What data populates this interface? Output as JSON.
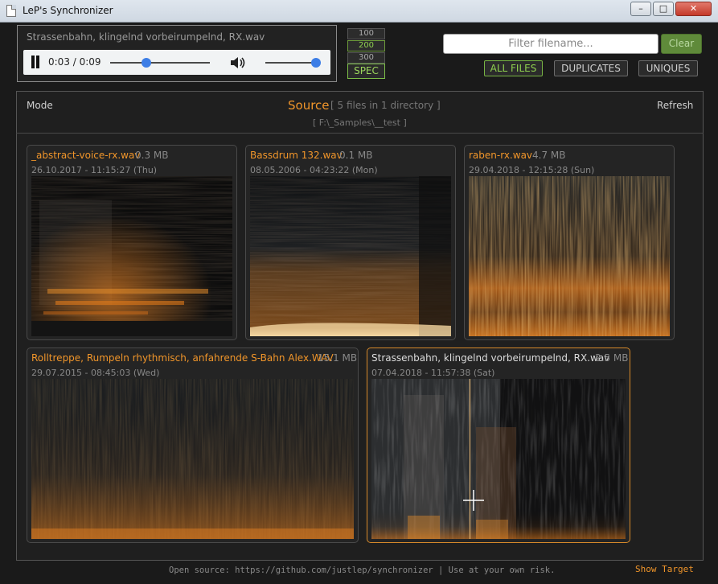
{
  "window": {
    "title": "LeP's Synchronizer"
  },
  "player": {
    "filename": "Strassenbahn, klingelnd vorbeirumpelnd, RX.wav",
    "time": "0:03 / 0:09",
    "progress": 0.36,
    "volume": 1.0
  },
  "spectro_res": {
    "options": [
      "100",
      "200",
      "300"
    ],
    "active": "200",
    "spec_label": "SPEC"
  },
  "filter": {
    "placeholder": "Filter filename...",
    "clear_label": "Clear"
  },
  "tabs": [
    {
      "label": "ALL FILES",
      "active": true
    },
    {
      "label": "DUPLICATES",
      "active": false
    },
    {
      "label": "UNIQUES",
      "active": false
    }
  ],
  "panel": {
    "mode_label": "Mode",
    "refresh_label": "Refresh",
    "title": "Source",
    "count": "[ 5 files in 1 directory ]",
    "path": "[ F:\\_Samples\\__test ]"
  },
  "files": [
    {
      "name": "_abstract-voice-rx.wav",
      "size": "0.3 MB",
      "date": "26.10.2017 - 11:15:27 (Thu)",
      "selected": false
    },
    {
      "name": "Bassdrum 132.wav",
      "size": "0.1 MB",
      "date": "08.05.2006 - 04:23:22 (Mon)",
      "selected": false
    },
    {
      "name": "raben-rx.wav",
      "size": "4.7 MB",
      "date": "29.04.2018 - 12:15:28 (Sun)",
      "selected": false
    },
    {
      "name": "Rolltreppe, Rumpeln rhythmisch, anfahrende S-Bahn Alex.WAV",
      "size": "15.1 MB",
      "date": "29.07.2015 - 08:45:03 (Wed)",
      "selected": false
    },
    {
      "name": "Strassenbahn, klingelnd vorbeirumpelnd, RX.wav",
      "size": "2.5 MB",
      "date": "07.04.2018 - 11:57:38 (Sat)",
      "selected": true
    }
  ],
  "footer": {
    "text": "Open source: https://github.com/justlep/synchronizer  |  Use at your own risk.",
    "show_target": "Show Target"
  },
  "colors": {
    "accent": "#f0952a",
    "green": "#8fd14f",
    "background": "#1a1a1a"
  }
}
